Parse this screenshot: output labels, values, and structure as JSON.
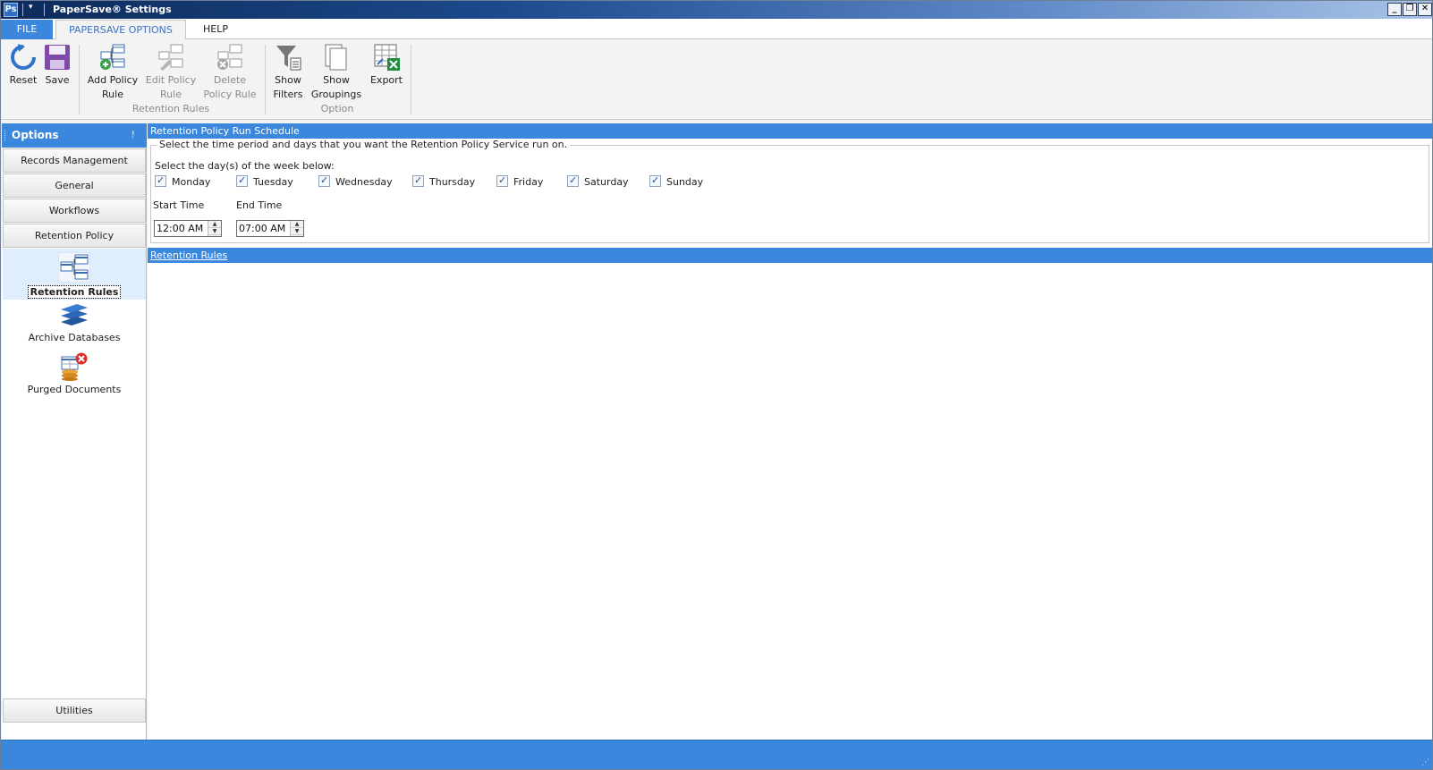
{
  "window": {
    "title": "PaperSave® Settings",
    "app_icon": "Ps"
  },
  "ribbon_tabs": [
    {
      "label": "FILE"
    },
    {
      "label": "PAPERSAVE OPTIONS"
    },
    {
      "label": "HELP"
    }
  ],
  "ribbon": {
    "reset": {
      "label": "Reset"
    },
    "save": {
      "label": "Save"
    },
    "add_policy_rule": {
      "line1": "Add Policy",
      "line2": "Rule"
    },
    "edit_policy_rule": {
      "line1": "Edit Policy",
      "line2": "Rule"
    },
    "delete_policy_rule": {
      "line1": "Delete",
      "line2": "Policy Rule"
    },
    "group_retention_rules": "Retention Rules",
    "show_filters": {
      "line1": "Show",
      "line2": "Filters"
    },
    "show_groupings": {
      "line1": "Show",
      "line2": "Groupings"
    },
    "export": {
      "label": "Export"
    },
    "group_option": "Option"
  },
  "sidebar": {
    "header": "Options",
    "pin": "ᚨ",
    "buttons": [
      "Records Management",
      "General",
      "Workflows",
      "Retention Policy"
    ],
    "items": [
      {
        "label": "Retention Rules",
        "icon": "retention-rules-icon"
      },
      {
        "label": "Archive Databases",
        "icon": "archive-databases-icon"
      },
      {
        "label": "Purged Documents",
        "icon": "purged-documents-icon"
      }
    ],
    "bottom_button": "Utilities"
  },
  "schedule": {
    "section_title": "Retention Policy Run Schedule",
    "legend": "Select the time period and days that you want the Retention Policy Service run on.",
    "days_prompt": "Select the day(s) of the week below:",
    "days": [
      "Monday",
      "Tuesday",
      "Wednesday",
      "Thursday",
      "Friday",
      "Saturday",
      "Sunday"
    ],
    "start_label": "Start Time",
    "start_value": "12:00 AM",
    "end_label": "End Time",
    "end_value": "07:00 AM"
  },
  "rules_section": {
    "title": "Retention Rules"
  },
  "colors": {
    "accent": "#3b87de",
    "title_bar": "#1c4a8c",
    "ribbon_bg": "#f3f3f3"
  }
}
